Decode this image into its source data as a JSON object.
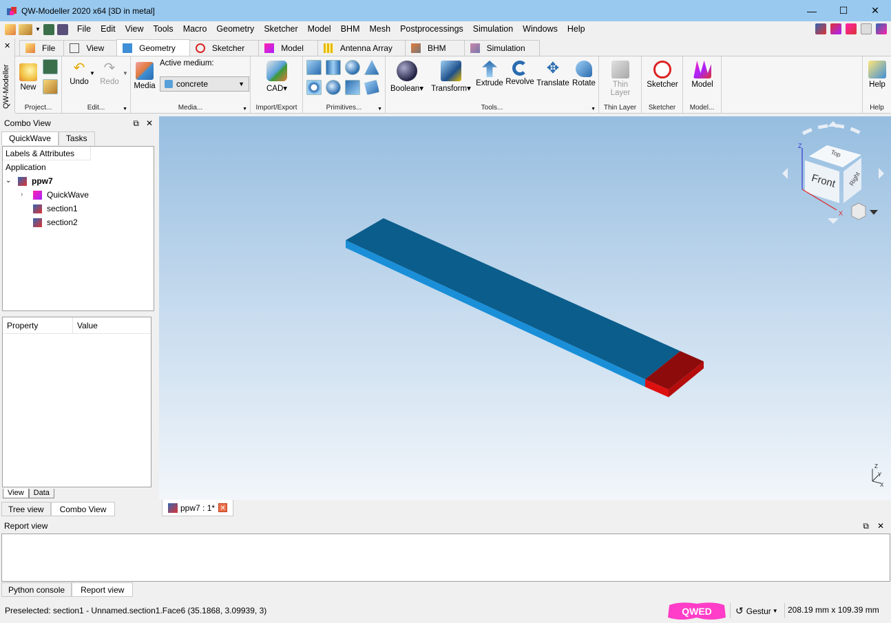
{
  "window": {
    "title": "QW-Modeller 2020 x64 [3D in metal]"
  },
  "menu": [
    "File",
    "Edit",
    "View",
    "Tools",
    "Macro",
    "Geometry",
    "Sketcher",
    "Model",
    "BHM",
    "Mesh",
    "Postprocessings",
    "Simulation",
    "Windows",
    "Help"
  ],
  "side_label": "QW-Modeller",
  "tabs": [
    {
      "label": "File",
      "icon": "file-icon"
    },
    {
      "label": "View",
      "icon": "view-cube-icon"
    },
    {
      "label": "Geometry",
      "icon": "geometry-icon"
    },
    {
      "label": "Sketcher",
      "icon": "sketcher-icon"
    },
    {
      "label": "Model",
      "icon": "model-icon"
    },
    {
      "label": "Antenna Array",
      "icon": "antenna-array-icon"
    },
    {
      "label": "BHM",
      "icon": "bhm-icon"
    },
    {
      "label": "Simulation",
      "icon": "simulation-icon"
    }
  ],
  "ribbon": {
    "project": {
      "new": "New",
      "label": "Project..."
    },
    "edit": {
      "undo": "Undo",
      "redo": "Redo",
      "label": "Edit..."
    },
    "media": {
      "media": "Media",
      "active_medium_label": "Active medium:",
      "active_medium": "concrete",
      "label": "Media..."
    },
    "import_export": {
      "cad": "CAD",
      "label": "Import/Export"
    },
    "primitives": {
      "label": "Primitives..."
    },
    "tools": {
      "boolean": "Boolean",
      "transform": "Transform",
      "extrude": "Extrude",
      "revolve": "Revolve",
      "translate": "Translate",
      "rotate": "Rotate",
      "label": "Tools..."
    },
    "thin_layer": {
      "btn": "Thin Layer",
      "label": "Thin Layer"
    },
    "sketcher": {
      "btn": "Sketcher",
      "label": "Sketcher"
    },
    "model": {
      "btn": "Model",
      "label": "Model..."
    },
    "help": {
      "btn": "Help",
      "label": "Help"
    }
  },
  "combo_view": {
    "title": "Combo View",
    "tabs": [
      "QuickWave",
      "Tasks"
    ],
    "tree_header": "Labels & Attributes",
    "tree": {
      "root": "Application",
      "doc": "ppw7",
      "items": [
        "QuickWave",
        "section1",
        "section2"
      ]
    },
    "property_headers": [
      "Property",
      "Value"
    ],
    "view_tabs": [
      "View",
      "Data"
    ],
    "bottom_tabs": [
      "Tree view",
      "Combo View"
    ]
  },
  "navcube": {
    "front": "Front",
    "top": "Top",
    "right": "Right",
    "z": "Z",
    "x": "X"
  },
  "axes": {
    "z": "Z",
    "y": "Y",
    "x": "X"
  },
  "document_tab": "ppw7 : 1*",
  "report": {
    "title": "Report view",
    "tabs": [
      "Python console",
      "Report view"
    ]
  },
  "status": {
    "message": "Preselected: section1 - Unnamed.section1.Face6 (35.1868, 3.09939, 3)",
    "logo": "QWED",
    "nav_style": "Gestur",
    "dimensions": "208.19 mm x 109.39 mm"
  },
  "colors": {
    "titlebar": "#99c9ef",
    "slab_top": "#0b5d8b",
    "slab_side": "#1a8fd8",
    "end_top": "#8e0b0b",
    "end_side": "#dd1010",
    "logo": "#ff3dc8"
  }
}
